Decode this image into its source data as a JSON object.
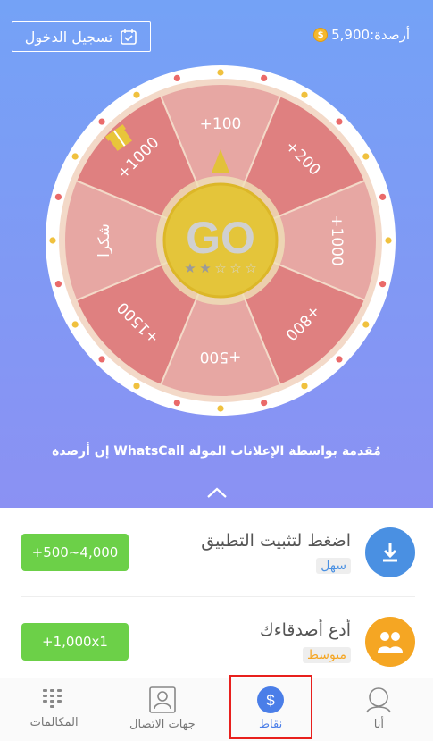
{
  "header": {
    "balance_label": "أرصدة:5,900",
    "checkin_label": "تسجيل الدخول"
  },
  "wheel": {
    "center_label": "GO",
    "stars_filled": 2,
    "stars_total": 5,
    "segments": [
      "+100",
      "+200",
      "+1000",
      "+800",
      "+500",
      "+1500",
      "شكرا",
      "+1000"
    ]
  },
  "disclaimer": "إن أرصدة WhatsCall مُقدمة بواسطة الإعلانات المولة",
  "tasks": [
    {
      "title": "اضغط لتثبيت التطبيق",
      "tag": "سهل",
      "reward": "+500~4,000",
      "icon": "download-icon"
    },
    {
      "title": "أدع أصدقاءك",
      "tag": "متوسط",
      "reward": "+1,000x1",
      "icon": "friends-icon"
    }
  ],
  "nav": {
    "calls": "المكالمات",
    "contacts": "جهات الاتصال",
    "points": "نقاط",
    "me": "أنا"
  },
  "colors": {
    "accent": "#4a7ee8",
    "reward_green": "#6cd048",
    "highlight_red": "#e8201d"
  }
}
